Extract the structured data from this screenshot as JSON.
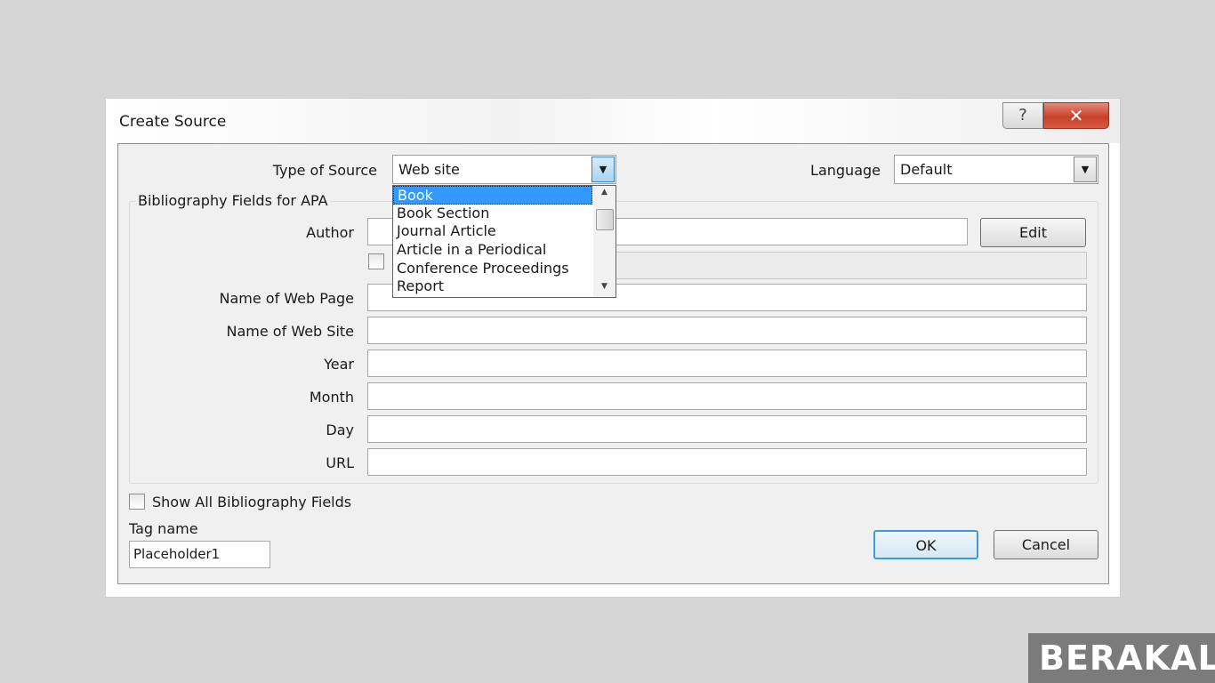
{
  "dialog": {
    "title": "Create Source",
    "help_label": "?",
    "close_label": "✕"
  },
  "type_of_source": {
    "label": "Type of Source",
    "value": "Web site",
    "options": [
      "Book",
      "Book Section",
      "Journal Article",
      "Article in a Periodical",
      "Conference Proceedings",
      "Report"
    ],
    "selected": "Book"
  },
  "language": {
    "label": "Language",
    "value": "Default"
  },
  "group": {
    "title": "Bibliography Fields for APA"
  },
  "fields": [
    {
      "label": "Author",
      "value": ""
    },
    {
      "label": "Name of Web Page",
      "value": ""
    },
    {
      "label": "Name of Web Site",
      "value": ""
    },
    {
      "label": "Year",
      "value": ""
    },
    {
      "label": "Month",
      "value": ""
    },
    {
      "label": "Day",
      "value": ""
    },
    {
      "label": "URL",
      "value": ""
    }
  ],
  "edit_label": "Edit",
  "show_all": {
    "label": "Show All Bibliography Fields",
    "checked": false
  },
  "tag": {
    "label": "Tag name",
    "value": "Placeholder1"
  },
  "ok_label": "OK",
  "cancel_label": "Cancel",
  "watermark": "BERAKAL",
  "colors": {
    "selection": "#3399ff",
    "close": "#c8412a"
  }
}
